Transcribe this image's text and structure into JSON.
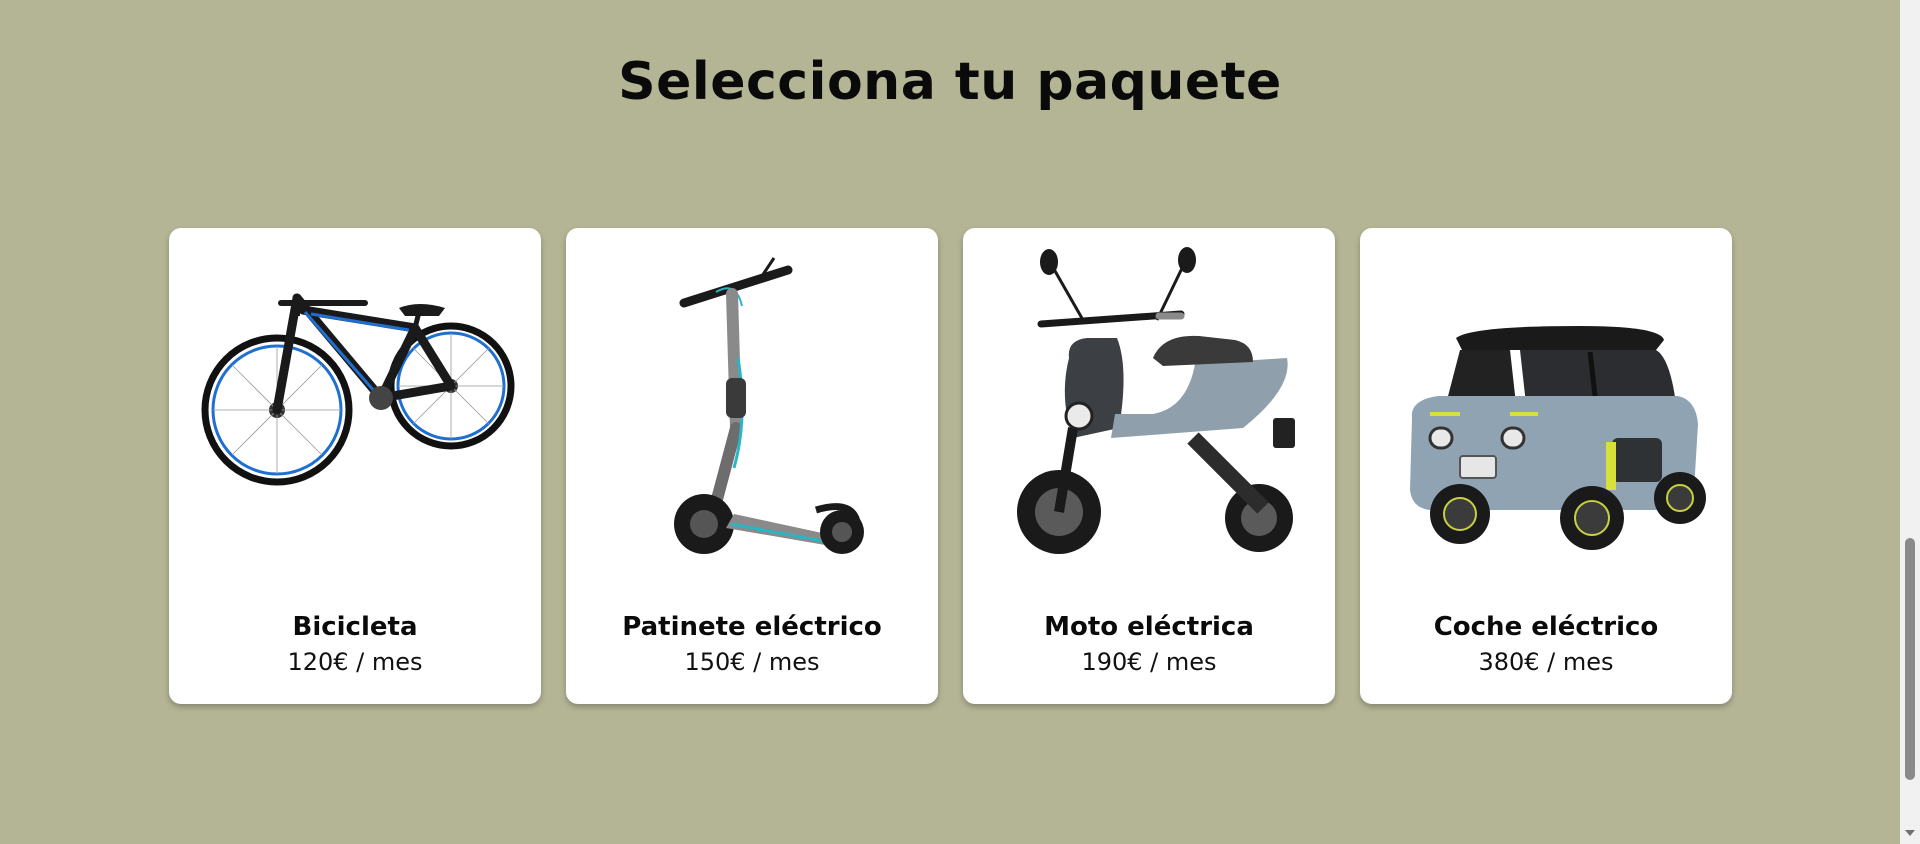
{
  "section": {
    "title": "Selecciona tu paquete"
  },
  "packages": [
    {
      "name": "Bicicleta",
      "price": "120€ / mes",
      "icon": "bicycle-image"
    },
    {
      "name": "Patinete eléctrico",
      "price": "150€ / mes",
      "icon": "electric-scooter-image"
    },
    {
      "name": "Moto eléctrica",
      "price": "190€ / mes",
      "icon": "electric-motorbike-image"
    },
    {
      "name": "Coche eléctrico",
      "price": "380€ / mes",
      "icon": "electric-car-image"
    }
  ],
  "colors": {
    "background": "#b4b595",
    "card": "#ffffff",
    "text": "#0a0a0a",
    "bike_accent": "#1f6fd1",
    "scooter_accent": "#2ab5c4",
    "car_body": "#8fa3b3",
    "car_accent": "#d8e03a"
  }
}
